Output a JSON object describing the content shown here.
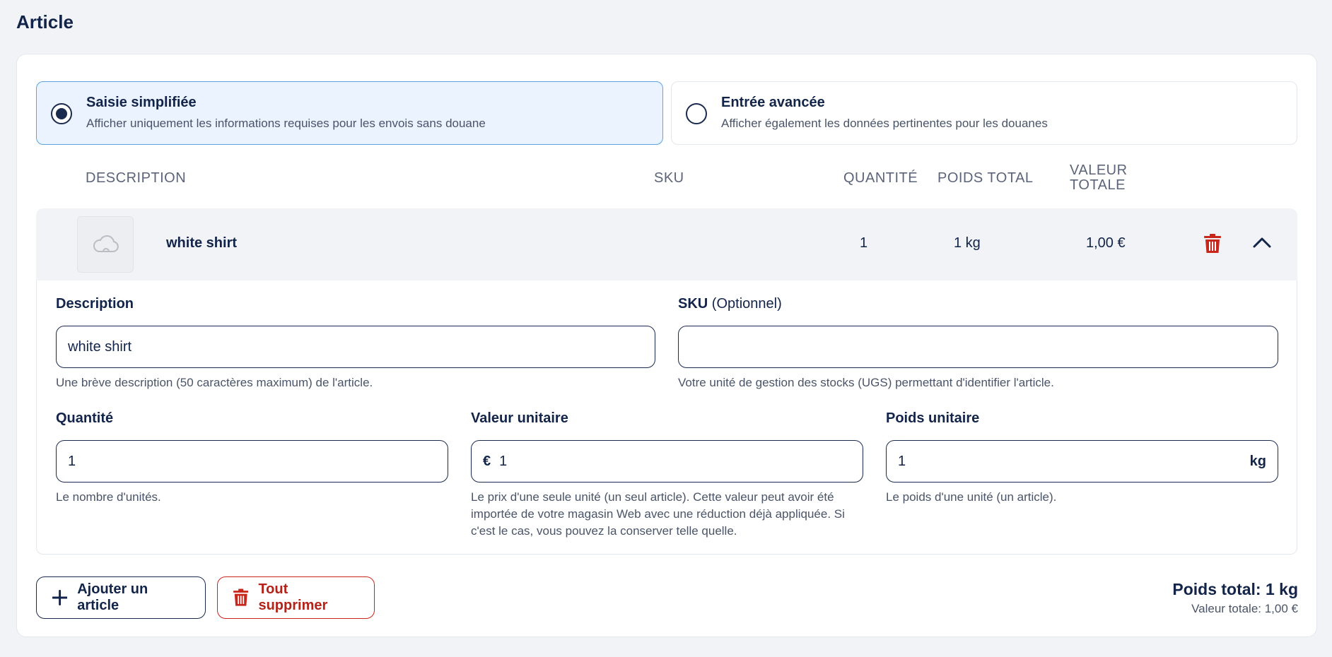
{
  "page": {
    "title": "Article"
  },
  "entry_modes": [
    {
      "title": "Saisie simplifiée",
      "description": "Afficher uniquement les informations requises pour les envois sans douane",
      "selected": true
    },
    {
      "title": "Entrée avancée",
      "description": "Afficher également les données pertinentes pour les douanes",
      "selected": false
    }
  ],
  "table": {
    "headers": {
      "description": "DESCRIPTION",
      "sku": "SKU",
      "quantity": "QUANTITÉ",
      "total_weight": "POIDS TOTAL",
      "total_value_line1": "VALEUR",
      "total_value_line2": "TOTALE"
    },
    "item": {
      "name": "white shirt",
      "sku": "",
      "quantity": "1",
      "total_weight": "1 kg",
      "total_value": "1,00 €",
      "thumbnail_icon": "cloud-icon",
      "delete_icon": "trash-icon",
      "collapse_icon": "chevron-up-icon"
    }
  },
  "form": {
    "description": {
      "label": "Description",
      "value": "white shirt",
      "help": "Une brève description (50 caractères maximum) de l'article."
    },
    "sku": {
      "label": "SKU",
      "optional": "(Optionnel)",
      "value": "",
      "help": "Votre unité de gestion des stocks (UGS) permettant d'identifier l'article."
    },
    "quantity": {
      "label": "Quantité",
      "value": "1",
      "help": "Le nombre d'unités."
    },
    "unit_value": {
      "label": "Valeur unitaire",
      "prefix": "€",
      "value": "1",
      "help_lines": [
        "Le prix d'une seule unité (un seul article). Cette valeur peut avoir été",
        "importée de votre magasin Web avec une réduction déjà appliquée. Si",
        "c'est le cas, vous pouvez la conserver telle quelle."
      ]
    },
    "unit_weight": {
      "label": "Poids unitaire",
      "value": "1",
      "suffix": "kg",
      "help": "Le poids d'une unité (un article)."
    }
  },
  "actions": {
    "add_label": "Ajouter un article",
    "delete_all_label": "Tout supprimer"
  },
  "totals": {
    "weight": "Poids total: 1 kg",
    "value": "Valeur totale: 1,00 €"
  },
  "colors": {
    "navy": "#13244a",
    "danger": "#b3231a",
    "selected_bg": "#eaf3ff",
    "selected_border": "#5aa4e6"
  }
}
